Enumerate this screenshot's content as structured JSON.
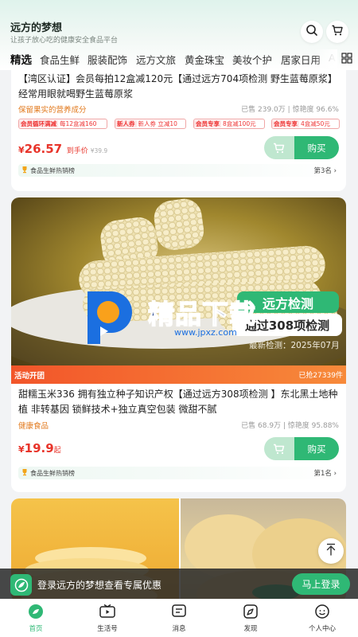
{
  "header": {
    "title": "远方的梦想",
    "subtitle": "让孩子放心吃的健康安全食品平台",
    "search_icon": "search-icon",
    "cart_icon": "cart-icon"
  },
  "categories": [
    "精选",
    "食品生鲜",
    "服装配饰",
    "远方文旅",
    "黄金珠宝",
    "美妆个护",
    "居家日用",
    "A"
  ],
  "products": [
    {
      "title": "【湾区认证】会员每拍12盒减120元【通过远方704项检测 野生蓝莓原浆】经常用眼就喝野生蓝莓原浆",
      "tagline": "保留果实的营养成分",
      "sales": "已售 239.0万 | 惊艳度 96.6%",
      "coupons": [
        {
          "type": "会员循环满减",
          "desc": "每12盒减160"
        },
        {
          "type": "新人券",
          "desc": "新人券 立减10"
        },
        {
          "type": "会员专享",
          "desc": "8盒减100元"
        },
        {
          "type": "会员专享",
          "desc": "4盒减50元"
        }
      ],
      "price": {
        "currency": "¥",
        "value": "26.57",
        "suffix": "到手价",
        "original": "¥39.9"
      },
      "buy_label": "购买",
      "rank": {
        "list": "食品生鲜热销榜",
        "position": "第3名"
      }
    },
    {
      "image_chips": {
        "badge": "远方检测",
        "line1": "通过308项检测",
        "line2": "最新检测：2025年07月"
      },
      "watermark": {
        "brand": "精品下载",
        "url": "www.jpxz.com"
      },
      "activity": {
        "label": "活动开团",
        "count": "已抢27339件"
      },
      "title": "甜糯玉米336 拥有独立种子知识产权【通过远方308项检测 】东北黑土地种植 非转基因 锁鲜技术+独立真空包装 微甜不腻",
      "tagline": "健康食品",
      "sales": "已售 68.9万 | 惊艳度 95.88%",
      "price": {
        "currency": "¥",
        "value": "19.9",
        "suffix": "起",
        "original": ""
      },
      "buy_label": "购买",
      "rank": {
        "list": "食品生鲜热销榜",
        "position": "第1名"
      }
    }
  ],
  "login_banner": {
    "text": "登录远方的梦想查看专属优惠",
    "button": "马上登录"
  },
  "tabbar": [
    {
      "label": "首页",
      "icon": "home-icon",
      "active": true
    },
    {
      "label": "生活号",
      "icon": "tv-icon",
      "active": false
    },
    {
      "label": "消息",
      "icon": "message-icon",
      "active": false
    },
    {
      "label": "发现",
      "icon": "discover-icon",
      "active": false
    },
    {
      "label": "个人中心",
      "icon": "profile-icon",
      "active": false
    }
  ],
  "colors": {
    "brand_green": "#2fb875",
    "price_red": "#e8342a",
    "tag_orange": "#e27a1e"
  }
}
